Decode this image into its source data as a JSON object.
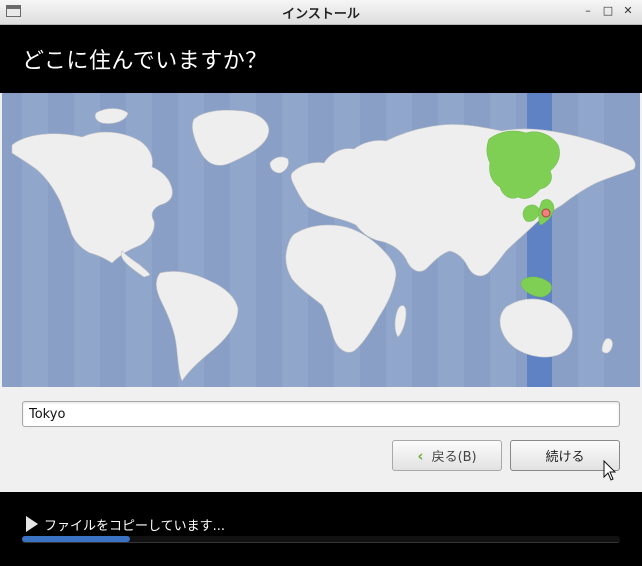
{
  "window": {
    "title": "インストール",
    "minimize": "–",
    "maximize": "□",
    "close": "✕"
  },
  "header": {
    "heading": "どこに住んでいますか？"
  },
  "location": {
    "city": "Tokyo"
  },
  "buttons": {
    "back_label": "戻る(B)",
    "back_icon": "chevron-left-icon",
    "continue_label": "続ける"
  },
  "footer": {
    "status": "ファイルをコピーしています...",
    "progress_fraction": 0.18
  },
  "colors": {
    "ocean": "#8a9fc6",
    "land": "#eeeeee",
    "timezone_highlight": "#5f82c4",
    "selected_region": "#7ecf53",
    "pin": "#f08080",
    "progress": "#3a72c4"
  }
}
